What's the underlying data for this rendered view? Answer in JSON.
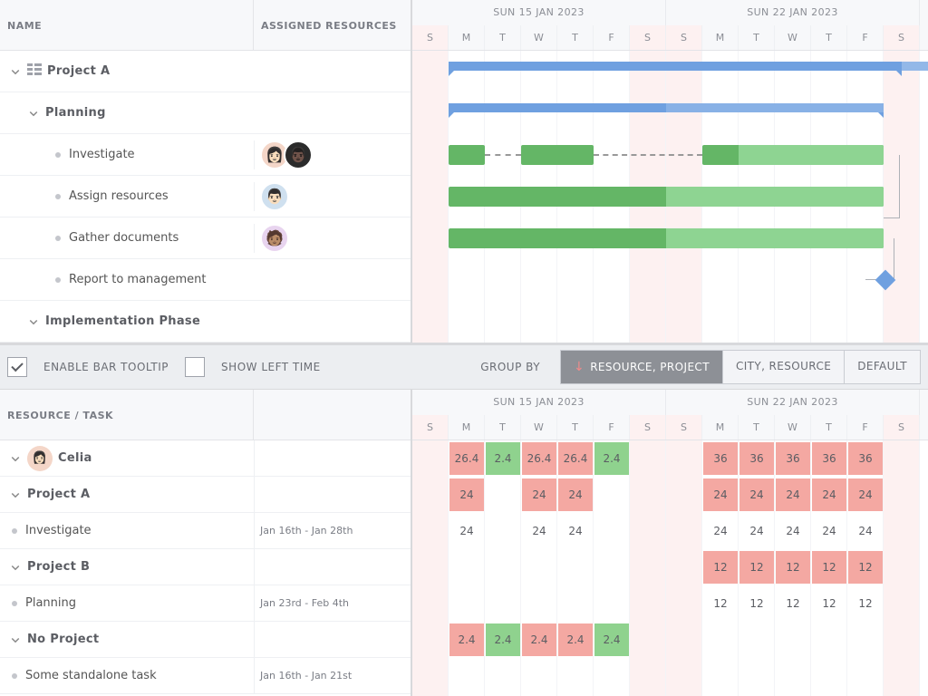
{
  "top": {
    "header": {
      "name": "Name",
      "resources": "Assigned Resources"
    },
    "timeline": {
      "weeks": [
        {
          "label": "Sun 15 Jan 2023",
          "days": [
            "S",
            "M",
            "T",
            "W",
            "T",
            "F",
            "S"
          ]
        },
        {
          "label": "Sun 22 Jan 2023",
          "days": [
            "S",
            "M",
            "T",
            "W",
            "T",
            "F",
            "S"
          ]
        }
      ]
    },
    "rows": [
      {
        "id": "proj-a",
        "label": "Project A",
        "level": 0,
        "type": "project",
        "expandable": true
      },
      {
        "id": "planning",
        "label": "Planning",
        "level": 1,
        "type": "summary",
        "expandable": true
      },
      {
        "id": "investigate",
        "label": "Investigate",
        "level": 2,
        "type": "task",
        "avatars": [
          "celia",
          "dan"
        ]
      },
      {
        "id": "assign-res",
        "label": "Assign resources",
        "level": 2,
        "type": "task",
        "avatars": [
          "mark"
        ]
      },
      {
        "id": "gather-docs",
        "label": "Gather documents",
        "level": 2,
        "type": "task",
        "avatars": [
          "lee"
        ]
      },
      {
        "id": "report-mgmt",
        "label": "Report to management",
        "level": 2,
        "type": "milestone"
      },
      {
        "id": "impl",
        "label": "Implementation Phase",
        "level": 1,
        "type": "summary",
        "expandable": true
      }
    ]
  },
  "toolbar": {
    "enable_tooltip": {
      "label": "Enable bar tooltip",
      "checked": true
    },
    "show_left_time": {
      "label": "Show left time",
      "checked": false
    },
    "group_by_label": "Group by",
    "buttons": {
      "resource_project": "Resource, Project",
      "city_resource": "City, Resource",
      "default": "Default"
    },
    "active": "resource_project"
  },
  "bottom": {
    "header": {
      "name": "Resource / Task"
    },
    "timeline": {
      "weeks": [
        {
          "label": "Sun 15 Jan 2023",
          "days": [
            "S",
            "M",
            "T",
            "W",
            "T",
            "F",
            "S"
          ]
        },
        {
          "label": "Sun 22 Jan 2023",
          "days": [
            "S",
            "M",
            "T",
            "W",
            "T",
            "F",
            "S"
          ]
        }
      ]
    },
    "rows": [
      {
        "id": "celia",
        "label": "Celia",
        "type": "resource",
        "expandable": true,
        "cells": [
          null,
          {
            "v": "26.4",
            "c": "red"
          },
          {
            "v": "2.4",
            "c": "grn"
          },
          {
            "v": "26.4",
            "c": "red"
          },
          {
            "v": "26.4",
            "c": "red"
          },
          {
            "v": "2.4",
            "c": "grn"
          },
          null,
          null,
          {
            "v": "36",
            "c": "red"
          },
          {
            "v": "36",
            "c": "red"
          },
          {
            "v": "36",
            "c": "red"
          },
          {
            "v": "36",
            "c": "red"
          },
          {
            "v": "36",
            "c": "red"
          },
          null
        ]
      },
      {
        "id": "celia-proja",
        "label": "Project A",
        "type": "summary",
        "level": 1,
        "expandable": true,
        "cells": [
          null,
          {
            "v": "24",
            "c": "red"
          },
          null,
          {
            "v": "24",
            "c": "red"
          },
          {
            "v": "24",
            "c": "red"
          },
          null,
          null,
          null,
          {
            "v": "24",
            "c": "red"
          },
          {
            "v": "24",
            "c": "red"
          },
          {
            "v": "24",
            "c": "red"
          },
          {
            "v": "24",
            "c": "red"
          },
          {
            "v": "24",
            "c": "red"
          },
          null
        ]
      },
      {
        "id": "celia-investigate",
        "label": "Investigate",
        "type": "task",
        "level": 2,
        "extra": "Jan 16th - Jan 28th",
        "cells": [
          null,
          {
            "v": "24",
            "c": "plain"
          },
          null,
          {
            "v": "24",
            "c": "plain"
          },
          {
            "v": "24",
            "c": "plain"
          },
          null,
          null,
          null,
          {
            "v": "24",
            "c": "plain"
          },
          {
            "v": "24",
            "c": "plain"
          },
          {
            "v": "24",
            "c": "plain"
          },
          {
            "v": "24",
            "c": "plain"
          },
          {
            "v": "24",
            "c": "plain"
          },
          null
        ]
      },
      {
        "id": "celia-projb",
        "label": "Project B",
        "type": "summary",
        "level": 1,
        "expandable": true,
        "cells": [
          null,
          null,
          null,
          null,
          null,
          null,
          null,
          null,
          {
            "v": "12",
            "c": "red"
          },
          {
            "v": "12",
            "c": "red"
          },
          {
            "v": "12",
            "c": "red"
          },
          {
            "v": "12",
            "c": "red"
          },
          {
            "v": "12",
            "c": "red"
          },
          null
        ]
      },
      {
        "id": "celia-planning",
        "label": "Planning",
        "type": "task",
        "level": 2,
        "extra": "Jan 23rd - Feb 4th",
        "cells": [
          null,
          null,
          null,
          null,
          null,
          null,
          null,
          null,
          {
            "v": "12",
            "c": "plain"
          },
          {
            "v": "12",
            "c": "plain"
          },
          {
            "v": "12",
            "c": "plain"
          },
          {
            "v": "12",
            "c": "plain"
          },
          {
            "v": "12",
            "c": "plain"
          },
          null
        ]
      },
      {
        "id": "celia-noproj",
        "label": "No Project",
        "type": "summary",
        "level": 1,
        "expandable": true,
        "cells": [
          null,
          {
            "v": "2.4",
            "c": "red"
          },
          {
            "v": "2.4",
            "c": "grn"
          },
          {
            "v": "2.4",
            "c": "red"
          },
          {
            "v": "2.4",
            "c": "red"
          },
          {
            "v": "2.4",
            "c": "grn"
          },
          null,
          null,
          null,
          null,
          null,
          null,
          null,
          null
        ]
      },
      {
        "id": "celia-standalone",
        "label": "Some standalone task",
        "type": "task",
        "level": 2,
        "extra": "Jan 16th - Jan 21st",
        "cells": [
          null,
          null,
          null,
          null,
          null,
          null,
          null,
          null,
          null,
          null,
          null,
          null,
          null,
          null
        ]
      }
    ]
  }
}
